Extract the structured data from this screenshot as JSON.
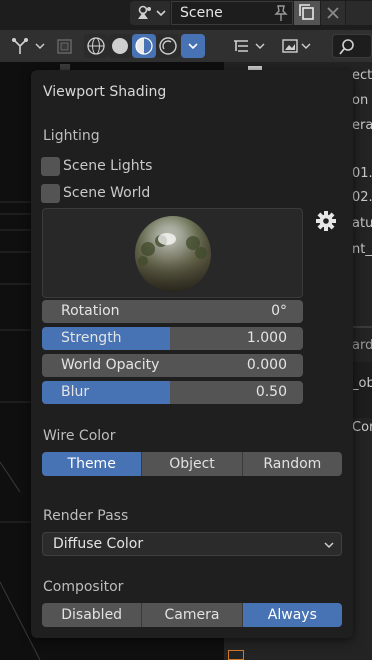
{
  "header": {
    "scene_name": "Scene"
  },
  "right_panel": {
    "fragments": [
      "ecti",
      "on",
      "era",
      "01.",
      "02.",
      "atur",
      "nt_(",
      "ard",
      "_ob",
      "Cor"
    ]
  },
  "popover": {
    "title": "Viewport Shading",
    "lighting": {
      "section_label": "Lighting",
      "scene_lights_label": "Scene Lights",
      "scene_lights_checked": false,
      "scene_world_label": "Scene World",
      "scene_world_checked": false
    },
    "sliders": {
      "rotation": {
        "label": "Rotation",
        "value": "0°"
      },
      "strength": {
        "label": "Strength",
        "value": "1.000"
      },
      "world_opacity": {
        "label": "World Opacity",
        "value": "0.000"
      },
      "blur": {
        "label": "Blur",
        "value": "0.50"
      }
    },
    "wire_color": {
      "section_label": "Wire Color",
      "options": [
        "Theme",
        "Object",
        "Random"
      ],
      "selected": "Theme"
    },
    "render_pass": {
      "section_label": "Render Pass",
      "value": "Diffuse Color"
    },
    "compositor": {
      "section_label": "Compositor",
      "options": [
        "Disabled",
        "Camera",
        "Always"
      ],
      "selected": "Always"
    }
  },
  "colors": {
    "accent": "#4772b3",
    "popover_bg": "#1f1f1f",
    "widget_bg": "#545454"
  }
}
